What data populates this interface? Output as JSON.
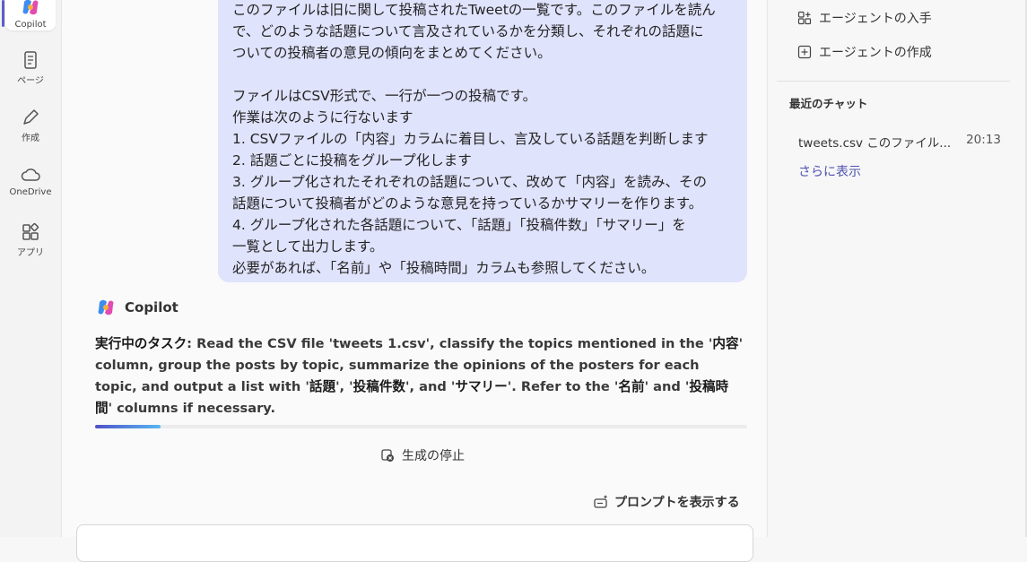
{
  "rail": {
    "items": [
      {
        "label": "Copilot",
        "icon": "copilot-icon"
      },
      {
        "label": "ページ",
        "icon": "page-icon"
      },
      {
        "label": "作成",
        "icon": "pen-icon"
      },
      {
        "label": "OneDrive",
        "icon": "cloud-icon"
      },
      {
        "label": "アプリ",
        "icon": "apps-icon"
      }
    ]
  },
  "user_message": {
    "lines": [
      "このファイルは旧に関して投稿されたTweetの一覧です。このファイルを読ん",
      "で、どのような話題について言及されているかを分類し、それぞれの話題に",
      "ついての投稿者の意見の傾向をまとめてください。",
      "",
      "ファイルはCSV形式で、一行が一つの投稿です。",
      "作業は次のように行ないます",
      "1. CSVファイルの「内容」カラムに着目し、言及している話題を判断します",
      "2. 話題ごとに投稿をグループ化します",
      "3. グループ化されたそれぞれの話題について、改めて「内容」を読み、その",
      "話題について投稿者がどのような意見を持っているかサマリーを作ります。",
      "4. グループ化された各話題について、「話題」「投稿件数」「サマリー」を",
      "一覧として出力します。",
      "必要があれば、「名前」や「投稿時間」カラムも参照してください。"
    ]
  },
  "assistant": {
    "name": "Copilot",
    "task_label": "実行中のタスク",
    "task_parts": [
      ": Read the CSV file 'tweets 1.csv', classify the topics mentioned in the '",
      "内容",
      "' column, group the posts by topic, summarize the opinions of the posters for each topic, and output a list with '",
      "話題",
      "', '",
      "投稿件数",
      "', and '",
      "サマリー",
      "'. Refer to the '",
      "名前",
      "' and '",
      "投稿時間",
      "' columns if necessary."
    ],
    "progress": 0.1
  },
  "stop_label": "生成の停止",
  "show_prompt_label": "プロンプトを表示する",
  "right_panel": {
    "get_agent": "エージェントの入手",
    "create_agent": "エージェントの作成",
    "recent_heading": "最近のチャット",
    "recent_chats": [
      {
        "title": "tweets.csv このファイル...",
        "time": "20:13"
      }
    ],
    "show_more": "さらに表示"
  },
  "colors": {
    "accent": "#5b5fc7",
    "bubble": "#e0e3fc",
    "link": "#4f52b2"
  }
}
